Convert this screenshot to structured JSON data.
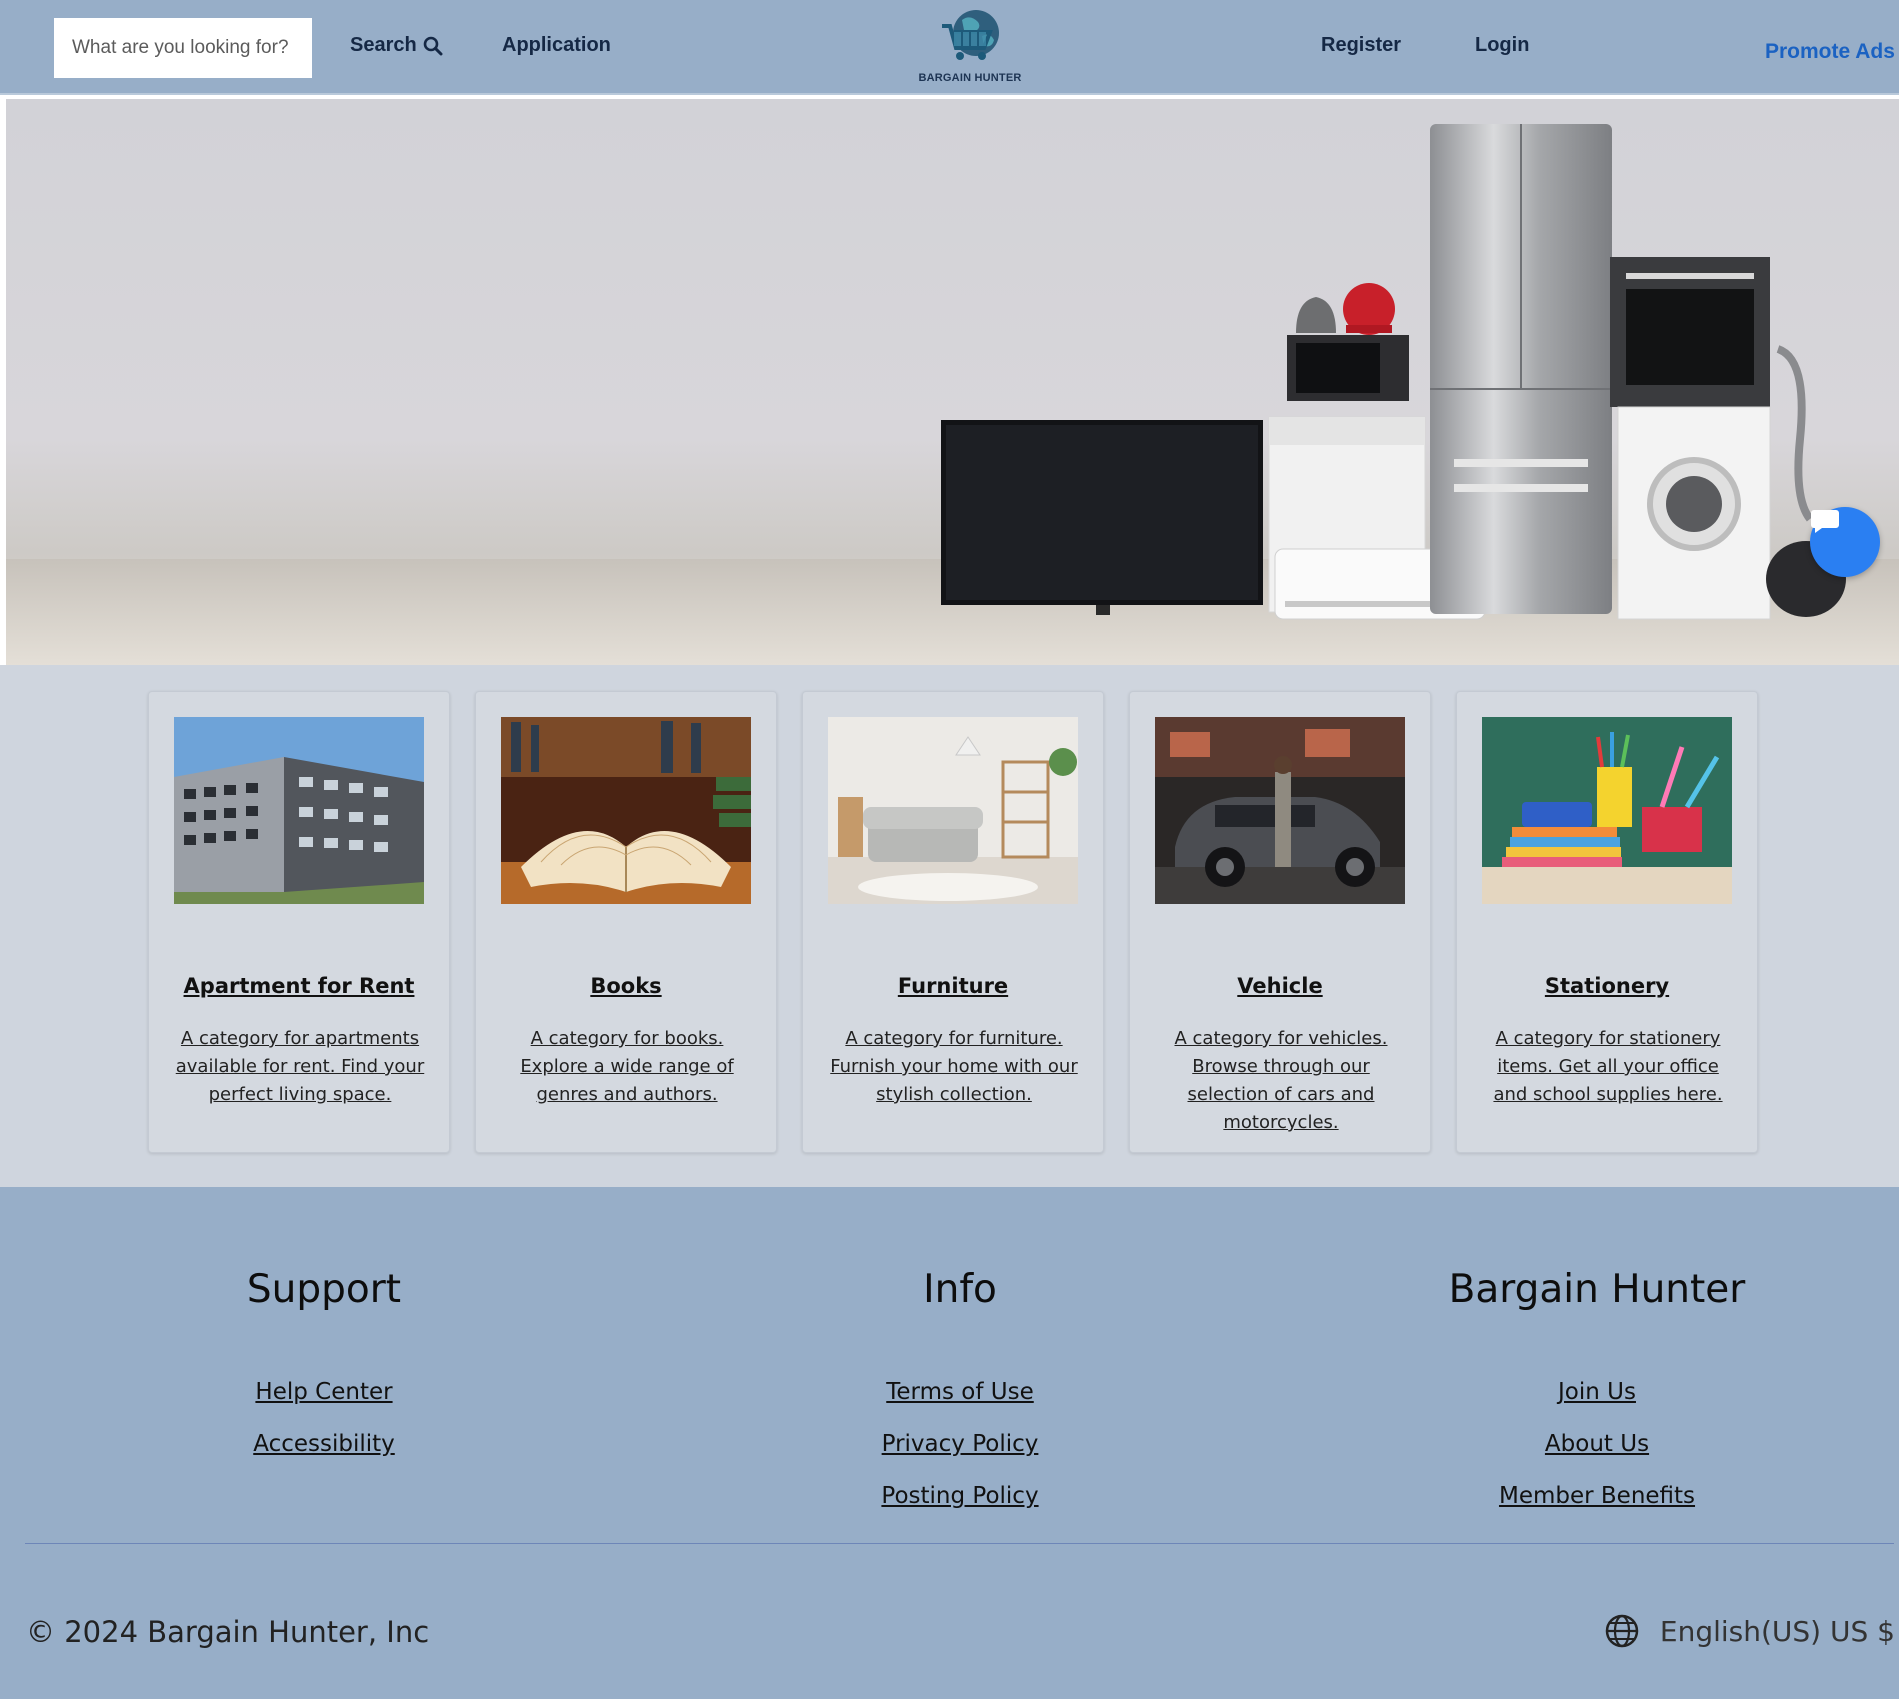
{
  "header": {
    "search_placeholder": "What are you looking for?",
    "search_label": "Search",
    "nav": {
      "application": "Application",
      "register": "Register",
      "login": "Login",
      "promote": "Promote Ads"
    },
    "logo_text": "BARGAIN HUNTER"
  },
  "categories": [
    {
      "title": "Apartment for Rent",
      "description": "A category for apartments available for rent. Find your perfect living space."
    },
    {
      "title": "Books",
      "description": "A category for books. Explore a wide range of genres and authors."
    },
    {
      "title": "Furniture",
      "description": "A category for furniture. Furnish your home with our stylish collection."
    },
    {
      "title": "Vehicle",
      "description": "A category for vehicles. Browse through our selection of cars and motorcycles."
    },
    {
      "title": "Stationery",
      "description": "A category for stationery items. Get all your office and school supplies here."
    }
  ],
  "footer": {
    "support": {
      "heading": "Support",
      "links": [
        "Help Center",
        "Accessibility"
      ]
    },
    "info": {
      "heading": "Info",
      "links": [
        "Terms of Use",
        "Privacy Policy",
        "Posting Policy"
      ]
    },
    "bargain_hunter": {
      "heading": "Bargain Hunter",
      "links": [
        "Join Us",
        "About Us",
        "Member Benefits"
      ]
    },
    "copyright": "© 2024 Bargain Hunter, Inc",
    "locale": "English(US) US $"
  },
  "colors": {
    "header_bg": "#97aec8",
    "accent": "#1b62c2",
    "chat": "#2a7ff2",
    "section_bg": "#cfd5de"
  },
  "icons": [
    "search-icon",
    "logo-cart-icon",
    "chat-icon",
    "globe-icon"
  ]
}
